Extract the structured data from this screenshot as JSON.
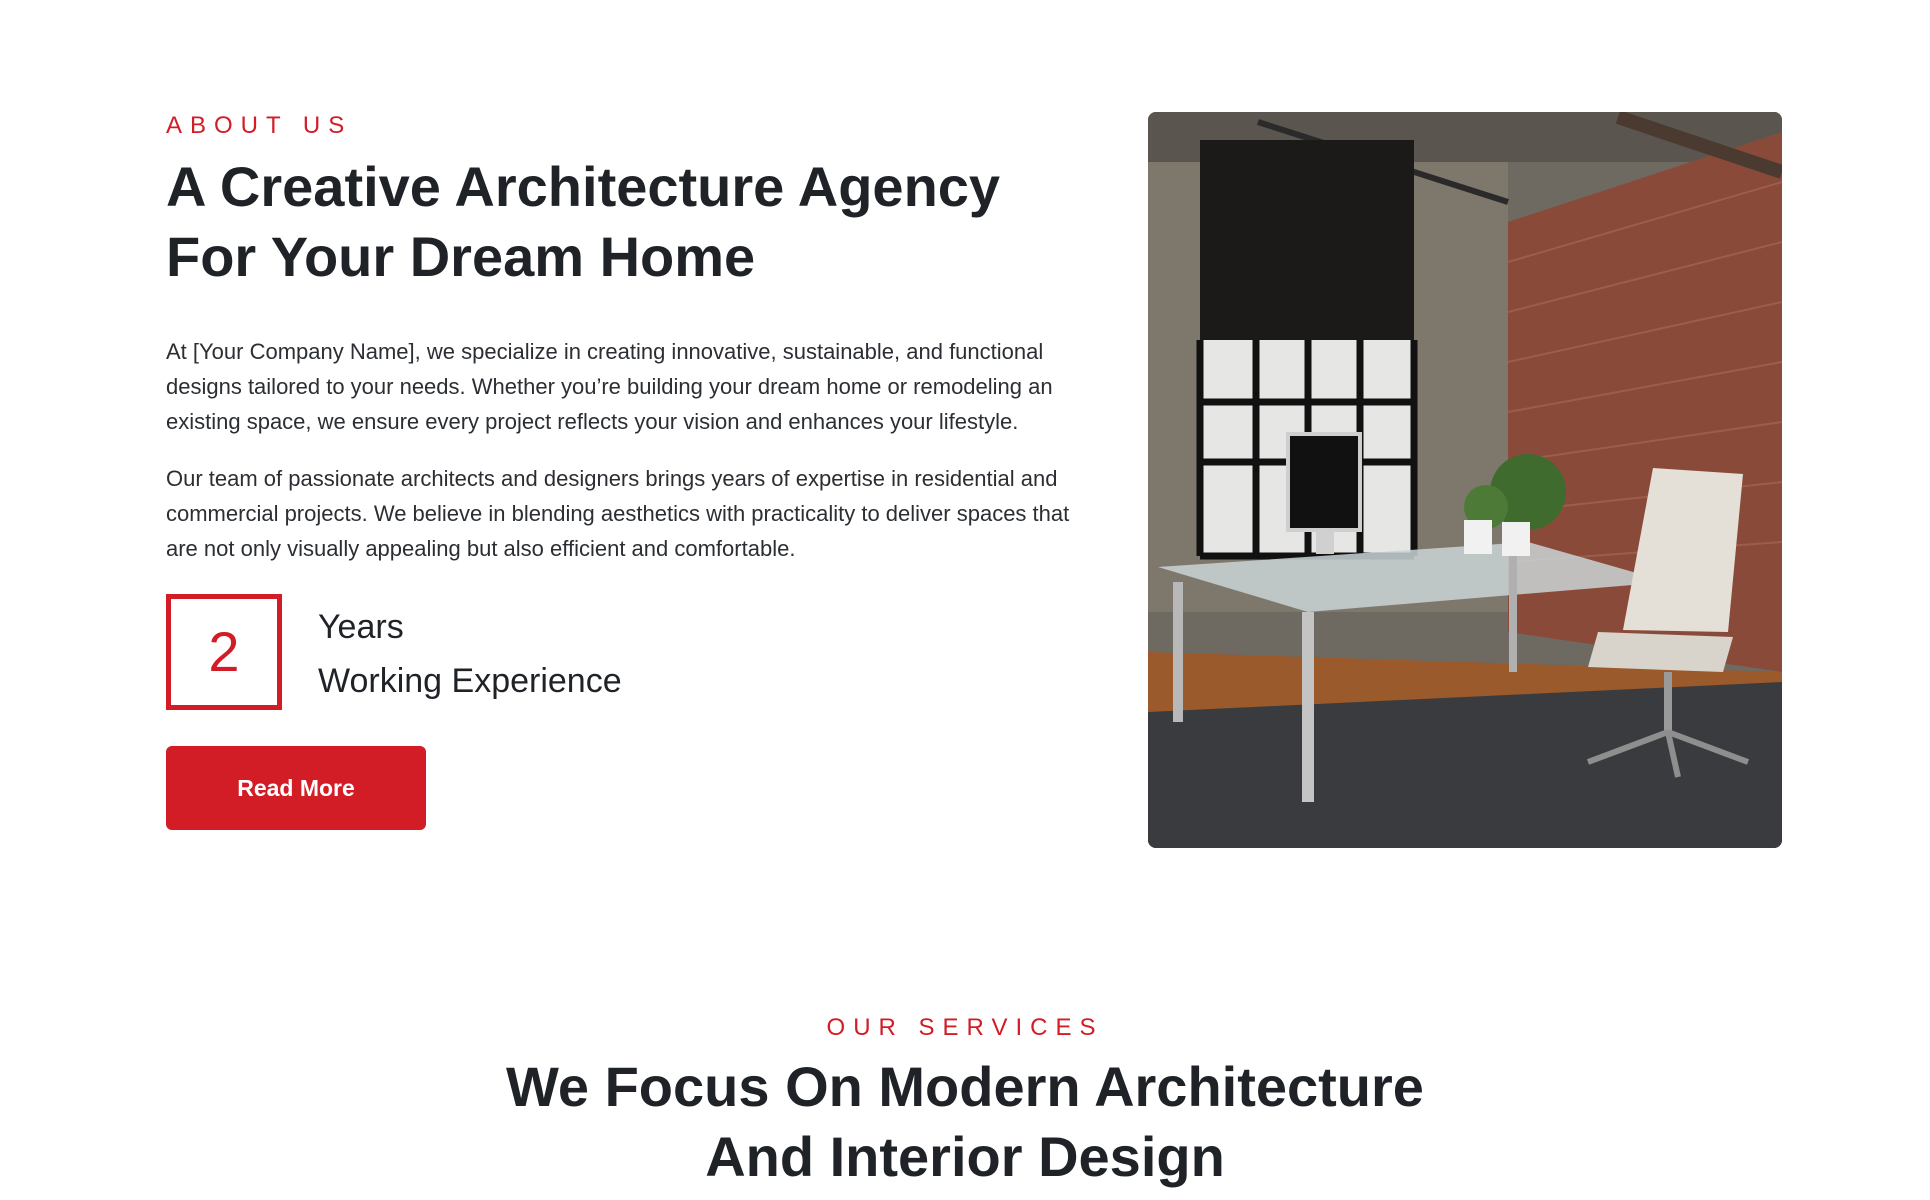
{
  "about": {
    "eyebrow": "ABOUT US",
    "heading_line1": "A Creative Architecture Agency",
    "heading_line2": "For Your Dream Home",
    "paragraph1": "At [Your Company Name], we specialize in creating innovative, sustainable, and functional designs tailored to your needs. Whether you’re building your dream home or remodeling an existing space, we ensure every project reflects your vision and enhances your lifestyle.",
    "paragraph2": "Our team of passionate architects and designers brings years of expertise in residential and commercial projects. We believe in blending aesthetics with practicality to deliver spaces that are not only visually appealing but also efficient and comfortable.",
    "stat_number": "2",
    "stat_label1": "Years",
    "stat_label2": "Working Experience",
    "button_label": "Read More",
    "image_subject": "loft-office-interior-photo"
  },
  "services": {
    "eyebrow": "OUR SERVICES",
    "heading_line1": "We Focus On Modern Architecture",
    "heading_line2": "And Interior Design"
  },
  "colors": {
    "accent": "#d21d27",
    "heading": "#1f2328",
    "body_text": "#2b2f33",
    "background": "#ffffff"
  }
}
